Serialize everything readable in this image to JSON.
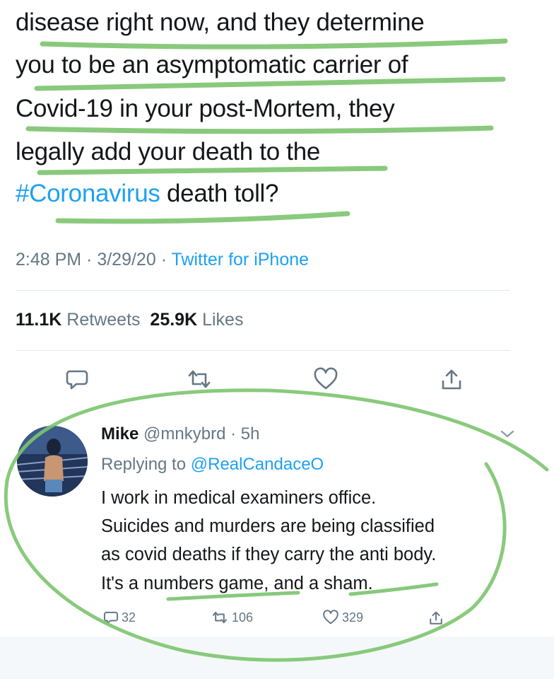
{
  "tweet": {
    "lines": [
      "disease right now, and they determine",
      "you to be an asymptomatic carrier of",
      "Covid-19 in your post-Mortem, they",
      "legally add your death to the"
    ],
    "last_line": {
      "hashtag": "#Coronavirus",
      "rest": " death toll?"
    },
    "time": "2:48 PM",
    "sep1": " · ",
    "date": "3/29/20",
    "sep2": " · ",
    "source": "Twitter for iPhone",
    "retweets_count": "11.1K",
    "retweets_label": "Retweets",
    "likes_count": "25.9K",
    "likes_label": "Likes"
  },
  "actions": {
    "reply_icon": "reply-bubble-icon",
    "retweet_icon": "retweet-icon",
    "like_icon": "heart-icon",
    "share_icon": "share-icon"
  },
  "reply": {
    "name": "Mike",
    "handle": "@mnkybrd",
    "sep": " · ",
    "time": "5h",
    "replying_prefix": "Replying to ",
    "replying_mention": "@RealCandaceO",
    "lines": [
      "I work in medical examiners office.",
      "Suicides and murders are being classified",
      "as covid deaths if they carry the anti body.",
      "It's a numbers game, and a sham."
    ],
    "reply_count": "32",
    "retweet_count": "106",
    "like_count": "329"
  },
  "colors": {
    "link": "#1da1f2",
    "meta": "#657786",
    "text": "#14171a",
    "annotation": "#7cc46e"
  }
}
